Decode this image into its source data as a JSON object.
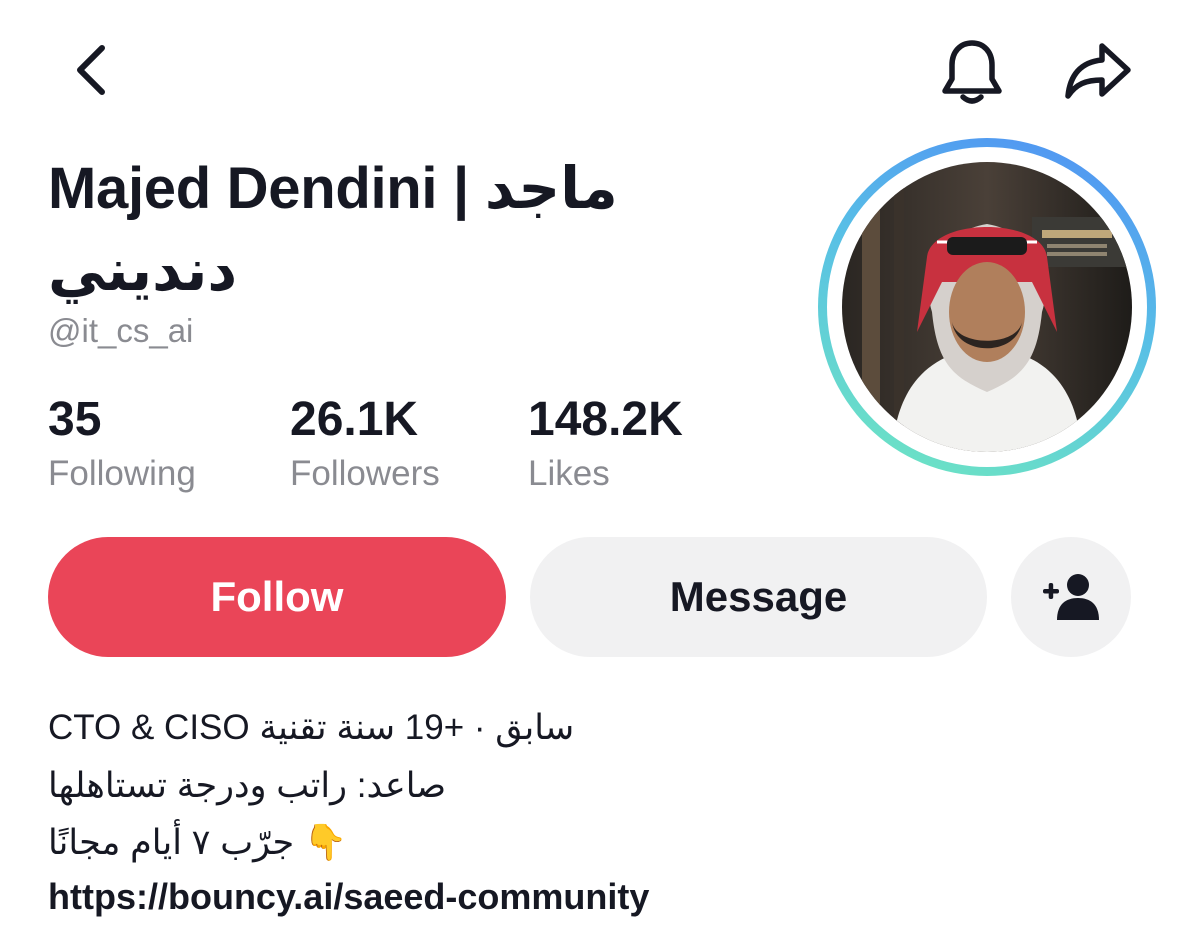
{
  "header": {
    "back_icon": "chevron-left-icon",
    "notification_icon": "bell-icon",
    "share_icon": "share-arrow-icon"
  },
  "profile": {
    "display_name": "Majed Dendini | ماجد دنديني",
    "handle": "@it_cs_ai",
    "avatar_icon": "profile-photo"
  },
  "stats": [
    {
      "value": "35",
      "label": "Following"
    },
    {
      "value": "26.1K",
      "label": "Followers"
    },
    {
      "value": "148.2K",
      "label": "Likes"
    }
  ],
  "actions": {
    "follow_label": "Follow",
    "message_label": "Message",
    "add_friend_icon": "add-person-icon"
  },
  "bio": {
    "line1": "CTO & CISO سابق · +19 سنة تقنية",
    "line2": "صاعد: راتب ودرجة تستاهلها",
    "line3": "جرّب ٧ أيام مجانًا 👇",
    "link": "https://bouncy.ai/saeed-community"
  },
  "colors": {
    "follow_button": "#ea4558",
    "secondary_button": "#f1f1f2",
    "muted_text": "#8a8b91",
    "ring_start": "#4f8df5",
    "ring_end": "#6fe8bf"
  }
}
